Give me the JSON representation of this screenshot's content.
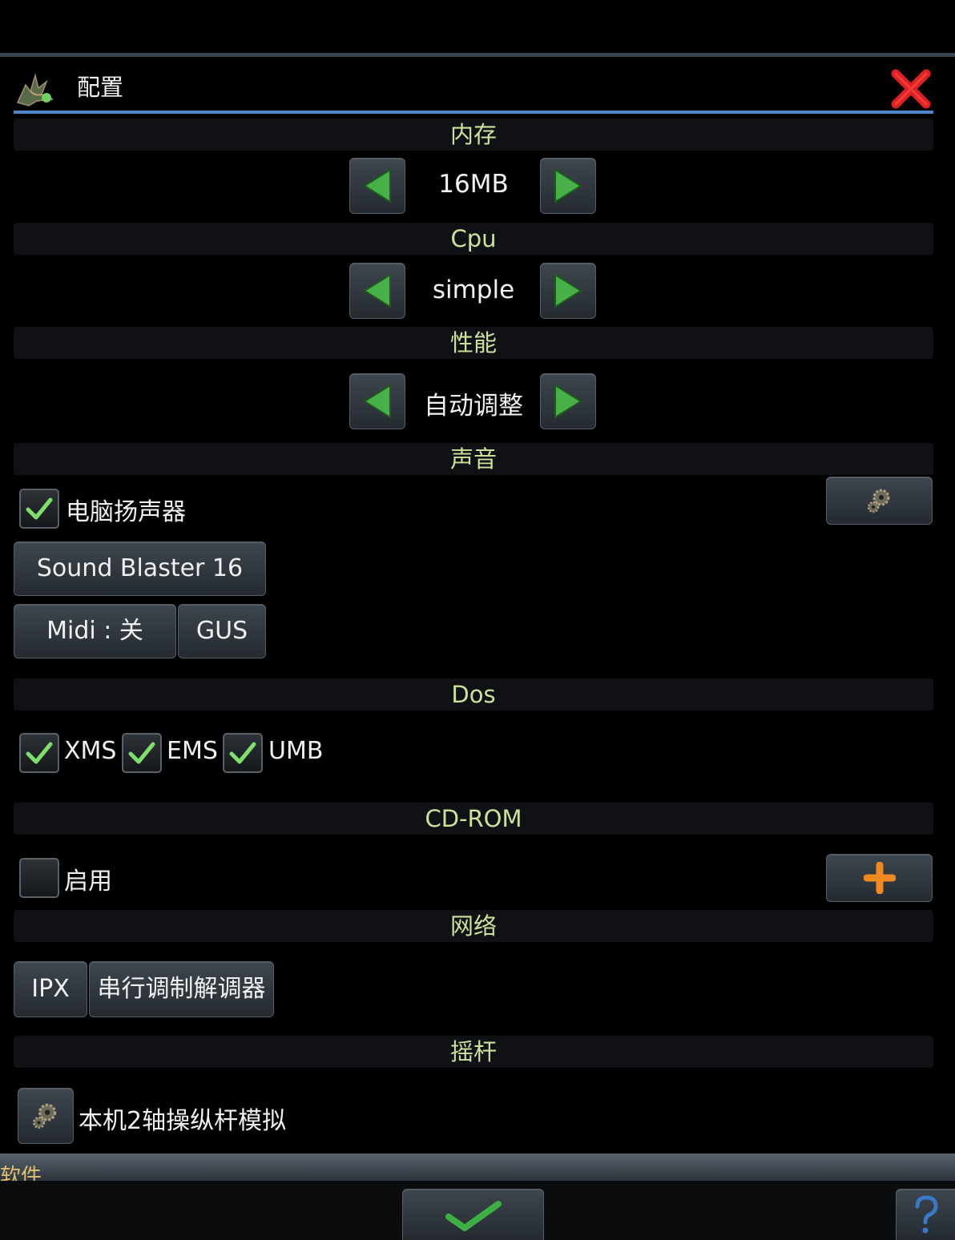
{
  "dialog": {
    "title": "配置",
    "icon": "dosbox-dragon-icon"
  },
  "memory": {
    "header": "内存",
    "value": "16MB"
  },
  "cpu": {
    "header": "Cpu",
    "value": "simple"
  },
  "performance": {
    "header": "性能",
    "value": "自动调整"
  },
  "sound": {
    "header": "声音",
    "pc_speaker": {
      "label": "电脑扬声器",
      "checked": true
    },
    "sb_button": "Sound Blaster 16",
    "midi_button": "Midi : 关",
    "gus_button": "GUS"
  },
  "dos": {
    "header": "Dos",
    "options": [
      {
        "label": "XMS",
        "checked": true
      },
      {
        "label": "EMS",
        "checked": true
      },
      {
        "label": "UMB",
        "checked": true
      }
    ]
  },
  "cdrom": {
    "header": "CD-ROM",
    "enable": {
      "label": "启用",
      "checked": false
    }
  },
  "network": {
    "header": "网络",
    "ipx_button": "IPX",
    "modem_button": "串行调制解调器"
  },
  "joystick": {
    "header": "摇杆",
    "label": "本机2轴操纵杆模拟"
  },
  "bottom": {
    "partial_label": "软件",
    "confirm_icon": "checkmark-icon",
    "help_icon": "question-mark-icon"
  },
  "colors": {
    "section_header_text": "#cfe09a",
    "accent_line": "#4a86c8",
    "arrow_green": "#4caf50",
    "close_red": "#e02020",
    "add_orange": "#f08a20"
  }
}
